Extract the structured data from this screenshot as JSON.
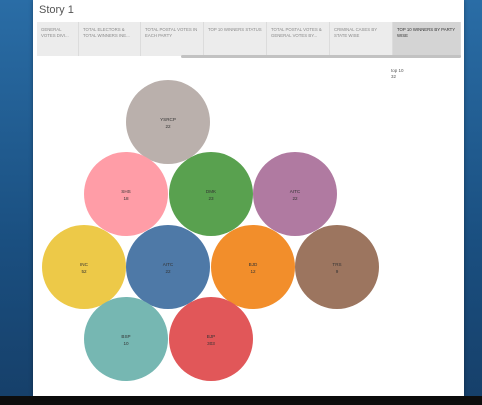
{
  "story": {
    "title": "Story 1"
  },
  "tabs": [
    {
      "label": "GENERAL VOTES DIVI...",
      "active": false
    },
    {
      "label": "TOTAL ELECTORS & TOTAL WINNERS INE...",
      "active": false
    },
    {
      "label": "TOTAL POSTAL VOTES IN EACH PARTY",
      "active": false
    },
    {
      "label": "TOP 10 WINNERS STATUS",
      "active": false
    },
    {
      "label": "TOTAL POSTAL VOTES & GENERAL VOTES BY...",
      "active": false
    },
    {
      "label": "CRIMINAL CASES BY STATE WISE",
      "active": false
    },
    {
      "label": "TOP 10 WINNERS BY PARTY WISE",
      "active": true
    }
  ],
  "legend": {
    "title": "top 10",
    "subtitle": "32"
  },
  "chart_data": {
    "type": "bubble",
    "bubbles": [
      {
        "party": "YSRCP",
        "value": "22",
        "color": "#bab0ac"
      },
      {
        "party": "SHS",
        "value": "18",
        "color": "#ff9da7"
      },
      {
        "party": "DMK",
        "value": "23",
        "color": "#59a14f"
      },
      {
        "party": "AITC",
        "value": "22",
        "color": "#b07aa1"
      },
      {
        "party": "INC",
        "value": "52",
        "color": "#edc948"
      },
      {
        "party": "AITC",
        "value": "22",
        "color": "#4e79a7"
      },
      {
        "party": "BJD",
        "value": "12",
        "color": "#f28e2b"
      },
      {
        "party": "TRS",
        "value": "9",
        "color": "#9c755f"
      },
      {
        "party": "BSP",
        "value": "10",
        "color": "#76b7b2"
      },
      {
        "party": "BJP",
        "value": "303",
        "color": "#e15759"
      }
    ]
  }
}
